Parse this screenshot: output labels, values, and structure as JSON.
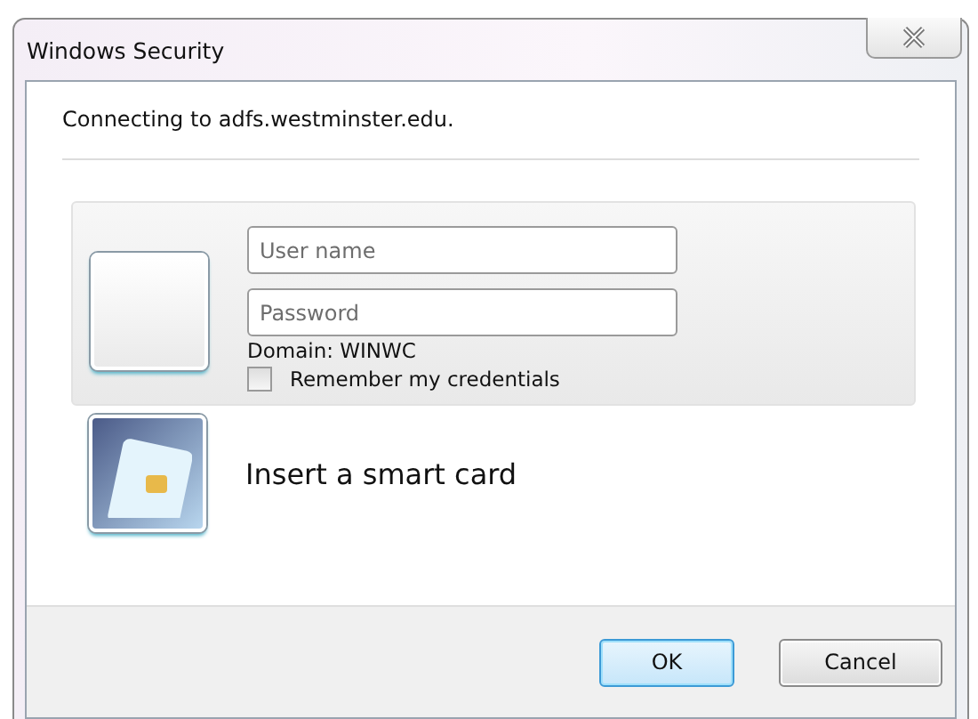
{
  "window": {
    "title": "Windows Security"
  },
  "message": "Connecting to adfs.westminster.edu.",
  "credential": {
    "username": {
      "placeholder": "User name"
    },
    "password": {
      "placeholder": "Password"
    },
    "domain": "Domain: WINWC",
    "remember": {
      "label": "Remember my credentials",
      "checked": false
    }
  },
  "smart_card": {
    "label": "Insert a smart card"
  },
  "buttons": [
    {
      "label": "OK",
      "default": true
    },
    {
      "label": "Cancel",
      "default": false
    }
  ]
}
